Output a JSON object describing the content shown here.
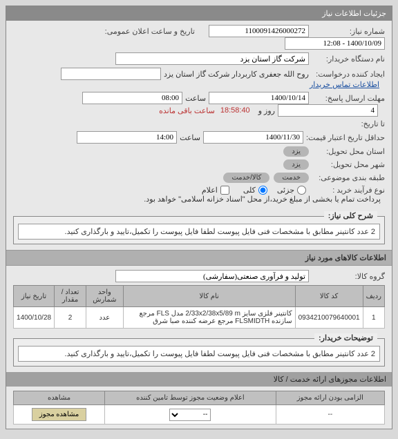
{
  "panel_title": "جزئیات اطلاعات نیاز",
  "fields": {
    "need_no_label": "شماره نیاز:",
    "need_no": "1100091426000272",
    "announce_label": "تاریخ و ساعت اعلان عمومی:",
    "announce": "1400/10/09 - 12:08",
    "org_label": "نام دستگاه خریدار:",
    "org": "شرکت گاز استان یزد",
    "creator_label": "ایجاد کننده درخواست:",
    "creator": "روح الله جعفری کاربردار شرکت گاز استان یزد",
    "contact_link": "اطلاعات تماس خریدار",
    "reply_deadline_label": "مهلت ارسال پاسخ:",
    "reply_date": "1400/10/14",
    "time_label": "ساعت",
    "reply_time": "08:00",
    "days_label": "روز و",
    "days": "4",
    "remaining_time": "18:58:40",
    "remaining_label": "ساعت باقی مانده",
    "until_label": "تا تاریخ:",
    "credit_label": "حداقل تاریخ اعتبار قیمت:",
    "credit_date": "1400/11/30",
    "credit_time": "14:00",
    "province_label": "استان محل تحویل:",
    "province": "یزد",
    "city_label": "شهر محل تحویل:",
    "city": "یزد",
    "category_label": "طبقه بندی موضوعی:",
    "cat_service": "خدمت",
    "cat_goods_service": "کالا/خدمت",
    "purchase_type_label": "نوع فرآیند خرید :",
    "pt_partial": "جزئی",
    "pt_full": "کلی",
    "payment_note": "پرداخت تمام یا بخشی از مبلغ خرید،از محل \"اسناد خزانه اسلامی\" خواهد بود.",
    "declare_check_label": "اعلام"
  },
  "summary": {
    "legend": "شرح کلی نیاز:",
    "text": "2 عدد کانتینر مطابق با مشخصات فنی فایل پیوست لطفا فایل پیوست را تکمیل،تایید و بارگذاری کنید."
  },
  "items_section": "اطلاعات کالاهای مورد نیاز",
  "group_label": "گروه کالا:",
  "group_value": "تولید و فرآوری صنعتی(سفارشی)",
  "table": {
    "headers": [
      "ردیف",
      "کد کالا",
      "نام کالا",
      "واحد شمارش",
      "تعداد / مقدار",
      "تاریخ نیاز"
    ],
    "rows": [
      {
        "idx": "1",
        "code": "0934210079640001",
        "name": "کانتینر فلزی سایز 2/33x2/38x5/89 m مدل FLS مرجع سازنده FLSMIDTH مرجع عرضه کننده صبا شرق",
        "unit": "عدد",
        "qty": "2",
        "date": "1400/10/28"
      }
    ]
  },
  "buyer_notes": {
    "legend": "توضیحات خریدار:",
    "text": "2 عدد کانتینر مطابق با مشخصات فنی فایل پیوست لطفا فایل پیوست را تکمیل،تایید و بارگذاری کنید."
  },
  "permits_header": "اطلاعات مجوزهای ارائه خدمت / کالا",
  "lower_table": {
    "headers": [
      "الزامی بودن ارائه مجوز",
      "اعلام وضعیت مجوز توسط تامین کننده",
      "مشاهده"
    ],
    "view_btn": "مشاهده مجوز",
    "dash": "--"
  }
}
